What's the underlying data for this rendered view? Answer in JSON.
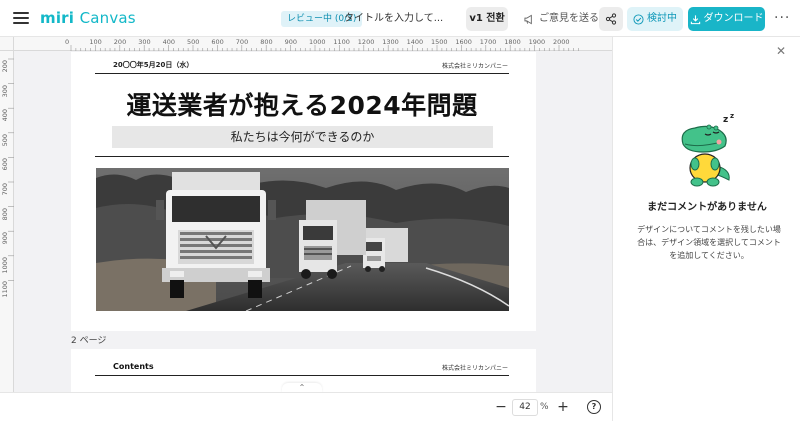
{
  "header": {
    "logo_part1": "miri",
    "logo_part2": "Canvas",
    "review_badge": "レビュー中 (0/1)",
    "doc_title": "タイトルを入力して...",
    "version_label": "v1 전환",
    "feedback_label": "ご意見を送る",
    "review_label": "検討中",
    "download_label": "ダウンロード"
  },
  "ruler": {
    "h_ticks": [
      "0",
      "100",
      "200",
      "300",
      "400",
      "500",
      "600",
      "700",
      "800",
      "900",
      "1000",
      "1100",
      "1200",
      "1300",
      "1400",
      "1500",
      "1600",
      "1700",
      "1800",
      "1900",
      "2000"
    ],
    "v_ticks": [
      "200",
      "300",
      "400",
      "500",
      "600",
      "700",
      "800",
      "900",
      "1000",
      "1100"
    ]
  },
  "page1": {
    "date": "20〇〇年5月20日（水）",
    "company": "株式会社ミリカンパニー",
    "headline": "運送業者が抱える2024年問題",
    "subtitle": "私たちは今何ができるのか"
  },
  "page2": {
    "label": "2 ページ",
    "contents": "Contents",
    "company": "株式会社ミリカンパニー"
  },
  "bottom": {
    "zoom_value": "42",
    "zoom_unit": "%"
  },
  "comments": {
    "empty_title": "まだコメントがありません",
    "empty_desc": "デザインについてコメントを残したい場合は、デザイン領域を選択してコメントを追加してください。"
  },
  "colors": {
    "accent": "#19b5c8",
    "review_bg": "#dff3f8",
    "mascot_green": "#43c28a",
    "mascot_yellow": "#ffd93a"
  }
}
